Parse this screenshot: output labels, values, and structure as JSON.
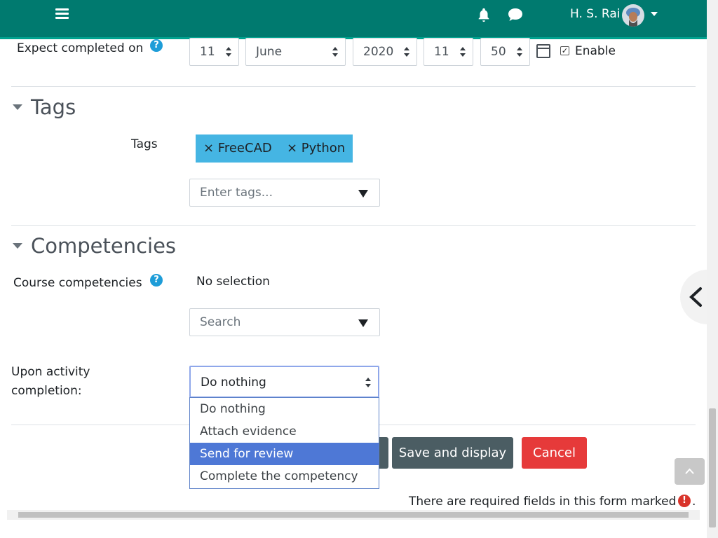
{
  "header": {
    "username": "H. S. Rai",
    "icons": [
      "menu-icon",
      "bell-icon",
      "chat-icon",
      "avatar",
      "caret-down-icon"
    ],
    "color": "#007a6f"
  },
  "expect_completed": {
    "label": "Expect completed on",
    "day": "11",
    "month": "June",
    "year": "2020",
    "hour": "11",
    "minute": "50",
    "enable_label": "Enable",
    "enabled": true
  },
  "tags_section": {
    "title": "Tags",
    "field_label": "Tags",
    "tags": [
      "× FreeCAD",
      "× Python"
    ],
    "placeholder": "Enter tags..."
  },
  "competencies_section": {
    "title": "Competencies",
    "course_label": "Course competencies",
    "no_selection": "No selection",
    "search_placeholder": "Search",
    "completion_label_line1": "Upon activity",
    "completion_label_line2": "completion:",
    "completion_value": "Do nothing",
    "options": [
      "Do nothing",
      "Attach evidence",
      "Send for review",
      "Complete the competency"
    ],
    "highlighted_option": "Send for review"
  },
  "buttons": {
    "save_display": "Save and display",
    "cancel": "Cancel"
  },
  "footer": {
    "required_text": "There are required fields in this form marked",
    "required_mark_suffix": "."
  }
}
